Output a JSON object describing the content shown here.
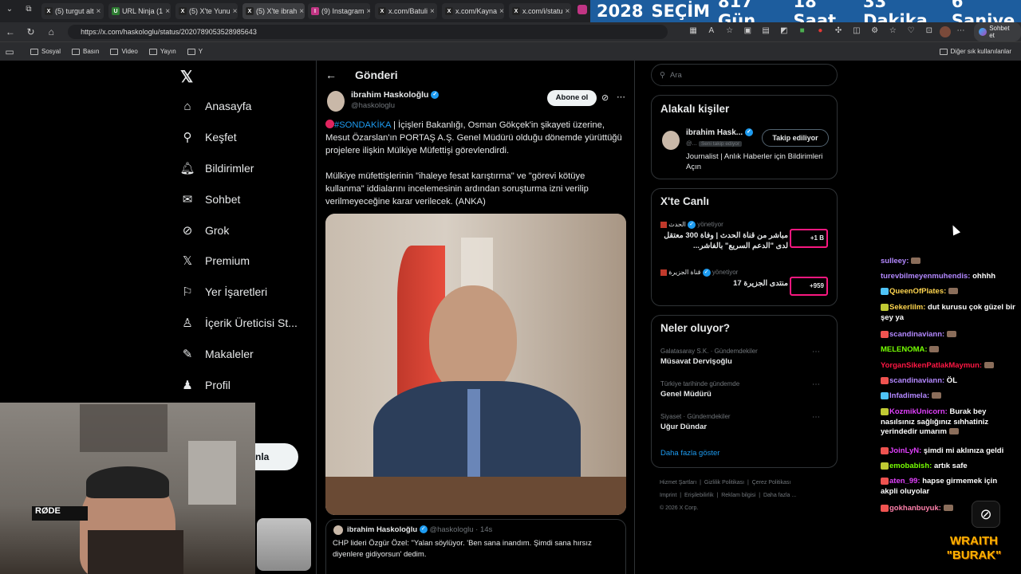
{
  "tabs": [
    {
      "label": "(5) turgut alt",
      "fav": "X",
      "color": "#222"
    },
    {
      "label": "URL Ninja (1",
      "fav": "U",
      "color": "#2e7d32"
    },
    {
      "label": "(5) X'te Yunu",
      "fav": "X",
      "color": "#222"
    },
    {
      "label": "(5) X'te ibrah",
      "fav": "X",
      "color": "#222"
    },
    {
      "label": "(9) Instagram",
      "fav": "I",
      "color": "#c13584"
    },
    {
      "label": "x.com/Batuli",
      "fav": "X",
      "color": "#222"
    },
    {
      "label": "x.com/Kayna",
      "fav": "X",
      "color": "#222"
    },
    {
      "label": "x.com/i/statu",
      "fav": "X",
      "color": "#222"
    }
  ],
  "countdown": {
    "year": "2028",
    "label": "SEÇİM",
    "days": "817 Gün",
    "hours": "18 Saat",
    "minutes": "33 Dakika",
    "seconds": "6 Saniye"
  },
  "browser": {
    "url": "https://x.com/haskologlu/status/2020789053528985643",
    "sohbet": "Sohbet et",
    "other_bookmarks": "Diğer sık kullanılanlar"
  },
  "bookmarks": [
    "Sosyal",
    "Basın",
    "Video",
    "Yayın",
    "Y"
  ],
  "nav": [
    "Anasayfa",
    "Keşfet",
    "Bildirimler",
    "Sohbet",
    "Grok",
    "Premium",
    "Yer İşaretleri",
    "İçerik Üreticisi St...",
    "Makaleler",
    "Profil"
  ],
  "post_button": "nla",
  "header": {
    "title": "Gönderi"
  },
  "tweet": {
    "name": "ibrahim Haskoloğlu",
    "handle": "@haskologlu",
    "subscribe": "Abone ol",
    "hashtag": "#SONDAKİKA",
    "p1_rest": " | İçişleri Bakanlığı, Osman Gökçek'in şikayeti üzerine, Mesut Özarslan'ın PORTAŞ A.Ş. Genel Müdürü olduğu dönemde yürüttüğü projelere ilişkin Mülkiye Müfettişi görevlendirdi.",
    "p2": "Mülkiye müfettişlerinin \"ihaleye fesat karıştırma\" ve \"görevi kötüye kullanma\" iddialarını incelemesinin ardından soruşturma izni verilip verilmeyeceğine karar verilecek. (ANKA)"
  },
  "quote": {
    "name": "ibrahim Haskoloğlu",
    "handle": "@haskologlu",
    "time": "· 14s",
    "text": "CHP lideri Özgür Özel: \"Yalan söylüyor. 'Ben sana inandım. Şimdi sana hırsız diyenlere gidiyorsun' dedim."
  },
  "search": {
    "placeholder": "Ara"
  },
  "related": {
    "title": "Alakalı kişiler",
    "name": "ibrahim Hask...",
    "handle": "@...",
    "follows_you": "Seni takip ediyor",
    "following": "Takip ediliyor",
    "bio": "Journalist | Anlık Haberler için Bildirimleri Açın"
  },
  "live": {
    "title": "X'te Canlı",
    "items": [
      {
        "host": "الحدث",
        "hosting": "yönetiyor",
        "text": "مباشر من قناة الحدث | وفاة 300 معتقل لدى \"الدعم السريع\" بالفاشر...",
        "count": "+1 B"
      },
      {
        "host": "قناة الجزيرة",
        "hosting": "yönetiyor",
        "text": "منتدى الجزيرة 17",
        "count": "+959"
      }
    ]
  },
  "happening": {
    "title": "Neler oluyor?",
    "items": [
      {
        "meta": "Galatasaray S.K. · Gündemdekiler",
        "title": "Müsavat Dervişoğlu"
      },
      {
        "meta": "Türkiye tarihinde gündemde",
        "title": "Genel Müdürü"
      },
      {
        "meta": "Siyaset · Gündemdekiler",
        "title": "Uğur Dündar"
      }
    ],
    "more": "Daha fazla göster"
  },
  "footer": {
    "links": [
      "Hizmet Şartları",
      "Gizlilik Politikası",
      "Çerez Politikası",
      "Imprint",
      "Erişilebilirlik",
      "Reklam bilgisi",
      "Daha fazla ..."
    ],
    "copyright": "© 2026 X Corp."
  },
  "chat": [
    {
      "user": "sulleey:",
      "msg": "",
      "ucolor": "#b388ff",
      "badge": "",
      "emote": true
    },
    {
      "user": "turevbilmeyenmuhendis:",
      "msg": " ohhhh",
      "ucolor": "#b388ff",
      "badge": "",
      "emote": false
    },
    {
      "user": "QueenOfPlates:",
      "msg": "",
      "ucolor": "#ffd54f",
      "badge": "#4fc3f7",
      "emote": true
    },
    {
      "user": "Sekerlilm:",
      "msg": " dut kurusu çok güzel bir şey ya",
      "ucolor": "#ffd54f",
      "badge": "#c0ca33",
      "emote": false
    },
    {
      "user": "scandinaviann:",
      "msg": "",
      "ucolor": "#b388ff",
      "badge": "#ef5350",
      "emote": true
    },
    {
      "user": "MELENOMA:",
      "msg": "",
      "ucolor": "#76ff03",
      "badge": "",
      "emote": true
    },
    {
      "user": "YorganSikenPatlakMaymun:",
      "msg": "",
      "ucolor": "#ff1744",
      "badge": "",
      "emote": true
    },
    {
      "user": "scandinaviann:",
      "msg": " ÖL",
      "ucolor": "#b388ff",
      "badge": "#ef5350",
      "emote": false
    },
    {
      "user": "Infadimela:",
      "msg": "",
      "ucolor": "#b388ff",
      "badge": "#4fc3f7",
      "emote": true
    },
    {
      "user": "KozmikUnicorn:",
      "msg": " Burak bey nasılsınız sağlığınız sıhhatiniz yerindedir umarım",
      "ucolor": "#e040fb",
      "badge": "#c0ca33",
      "emote": true
    },
    {
      "user": "JoinLyN:",
      "msg": " şimdi mi aklınıza geldi",
      "ucolor": "#e040fb",
      "badge": "#ef5350",
      "emote": false
    },
    {
      "user": "emobabish:",
      "msg": " artık safe",
      "ucolor": "#76ff03",
      "badge": "#c0ca33",
      "emote": false
    },
    {
      "user": "aten_99:",
      "msg": " hapse girmemek için akpli oluyolar",
      "ucolor": "#e040fb",
      "badge": "#ef5350",
      "emote": false
    },
    {
      "user": "gokhanbuyuk:",
      "msg": "",
      "ucolor": "#ff80ab",
      "badge": "#ef5350",
      "emote": true
    }
  ],
  "overlay": {
    "line1": "WRAITH",
    "line2": "\"BURAK\""
  },
  "colors": {
    "accent": "#1d9bf0",
    "countdown_bg": "#1d5d9e"
  }
}
